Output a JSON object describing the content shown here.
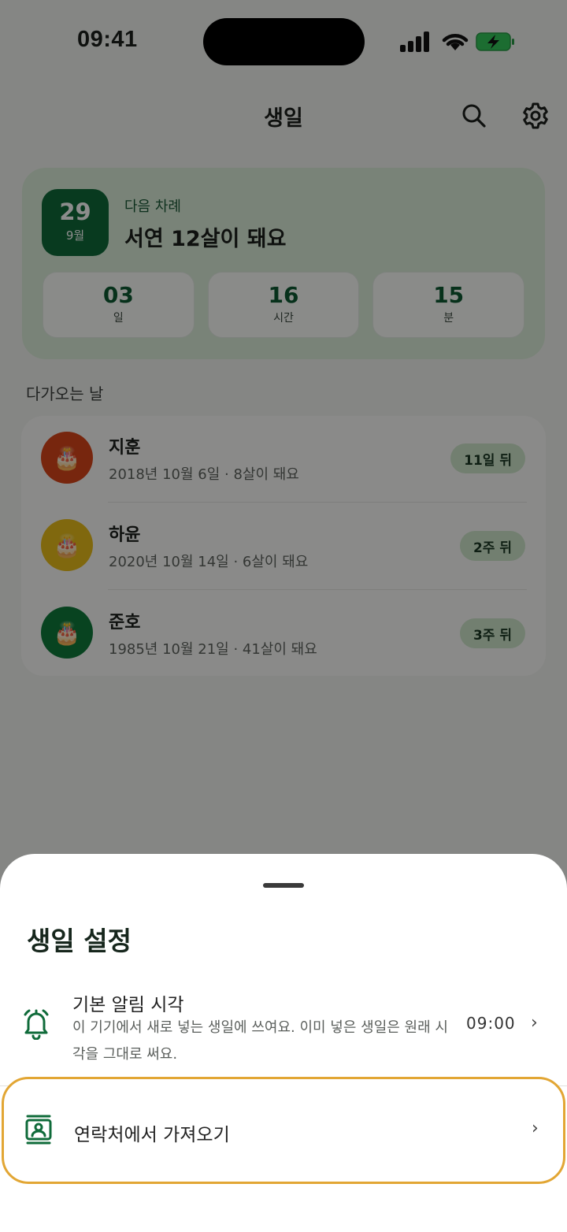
{
  "status_bar": {
    "time": "09:41"
  },
  "header": {
    "title": "생일",
    "search_icon": "search-icon",
    "settings_icon": "gear-icon"
  },
  "next": {
    "day": "29",
    "month": "9월",
    "label": "다음 차례",
    "title": "서연 12살이 돼요",
    "countdown": [
      {
        "value": "03",
        "unit": "일"
      },
      {
        "value": "16",
        "unit": "시간"
      },
      {
        "value": "15",
        "unit": "분"
      }
    ]
  },
  "upcoming": {
    "label": "다가오는 날",
    "items": [
      {
        "name": "지훈",
        "detail": "2018년 10월 6일 · 8살이 돼요",
        "badge": "11일 뒤",
        "color": "#d9461b"
      },
      {
        "name": "하윤",
        "detail": "2020년 10월 14일 · 6살이 돼요",
        "badge": "2주 뒤",
        "color": "#e9bd1b"
      },
      {
        "name": "준호",
        "detail": "1985년 10월 21일 · 41살이 돼요",
        "badge": "3주 뒤",
        "color": "#0f7a3b"
      }
    ]
  },
  "sheet": {
    "title": "생일 설정",
    "alarm": {
      "title": "기본 알림 시각",
      "description": "이 기기에서 새로 넣는 생일에 쓰여요. 이미 넣은 생일은 원래 시각을 그대로 써요.",
      "value": "09:00"
    },
    "contacts": {
      "label": "연락처에서 가져오기"
    }
  },
  "colors": {
    "accent": "#0f6b3a",
    "highlight": "#e2a634"
  }
}
